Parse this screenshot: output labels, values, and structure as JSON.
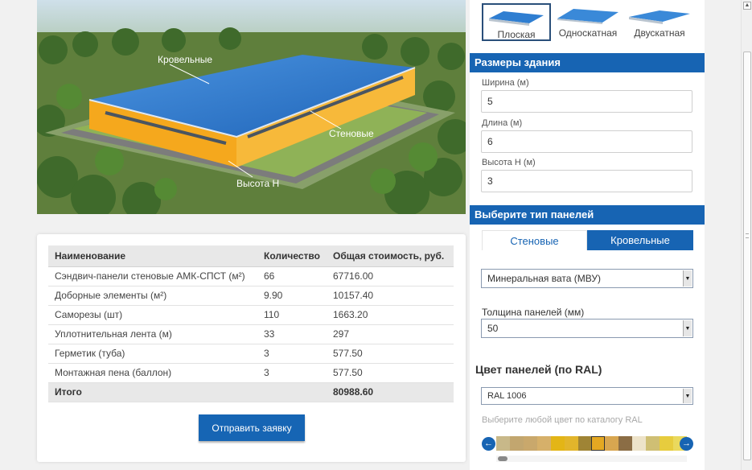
{
  "illustration": {
    "label_roof": "Кровельные",
    "label_wall": "Стеновые",
    "label_height": "Высота Н"
  },
  "table": {
    "headers": [
      "Наименование",
      "Количество",
      "Общая стоимость, руб."
    ],
    "rows": [
      {
        "name": "Сэндвич-панели стеновые АМК-СПСТ (м²)",
        "qty": "66",
        "cost": "67716.00"
      },
      {
        "name": "Доборные элементы (м²)",
        "qty": "9.90",
        "cost": "10157.40"
      },
      {
        "name": "Саморезы (шт)",
        "qty": "110",
        "cost": "1663.20"
      },
      {
        "name": "Уплотнительная лента (м)",
        "qty": "33",
        "cost": "297"
      },
      {
        "name": "Герметик (туба)",
        "qty": "3",
        "cost": "577.50"
      },
      {
        "name": "Монтажная пена (баллон)",
        "qty": "3",
        "cost": "577.50"
      }
    ],
    "total": {
      "name": "Итого",
      "qty": "",
      "cost": "80988.60"
    }
  },
  "submit_label": "Отправить заявку",
  "roof_types": [
    "Плоская",
    "Односкатная",
    "Двускатная"
  ],
  "dimensions": {
    "title": "Размеры здания",
    "width_label": "Ширина (м)",
    "width_value": "5",
    "length_label": "Длина (м)",
    "length_value": "6",
    "height_label": "Высота Н (м)",
    "height_value": "3"
  },
  "panel_type": {
    "title": "Выберите тип панелей",
    "tab_wall": "Стеновые",
    "tab_roof": "Кровельные",
    "material_value": "Минеральная вата (МВУ)",
    "thickness_label": "Толщина панелей (мм)",
    "thickness_value": "50"
  },
  "color": {
    "title": "Цвет панелей (по RAL)",
    "ral_value": "RAL 1006",
    "hint": "Выберите любой цвет по каталогу RAL",
    "swatches": [
      "#c8b889",
      "#c2a66f",
      "#c9a86c",
      "#d6b06a",
      "#e3b516",
      "#e2b52b",
      "#9f8435",
      "#e4a822",
      "#d8a650",
      "#8b6d45",
      "#ede3c9",
      "#cfbf74",
      "#e7cc3e",
      "#ead95d"
    ],
    "active_index": 7,
    "prev_icon": "arrow-left-icon",
    "next_icon": "arrow-right-icon"
  },
  "colors": {
    "accent": "#1764b3",
    "building_wall": "#f5a81d",
    "building_roof": "#2f7ed1"
  }
}
